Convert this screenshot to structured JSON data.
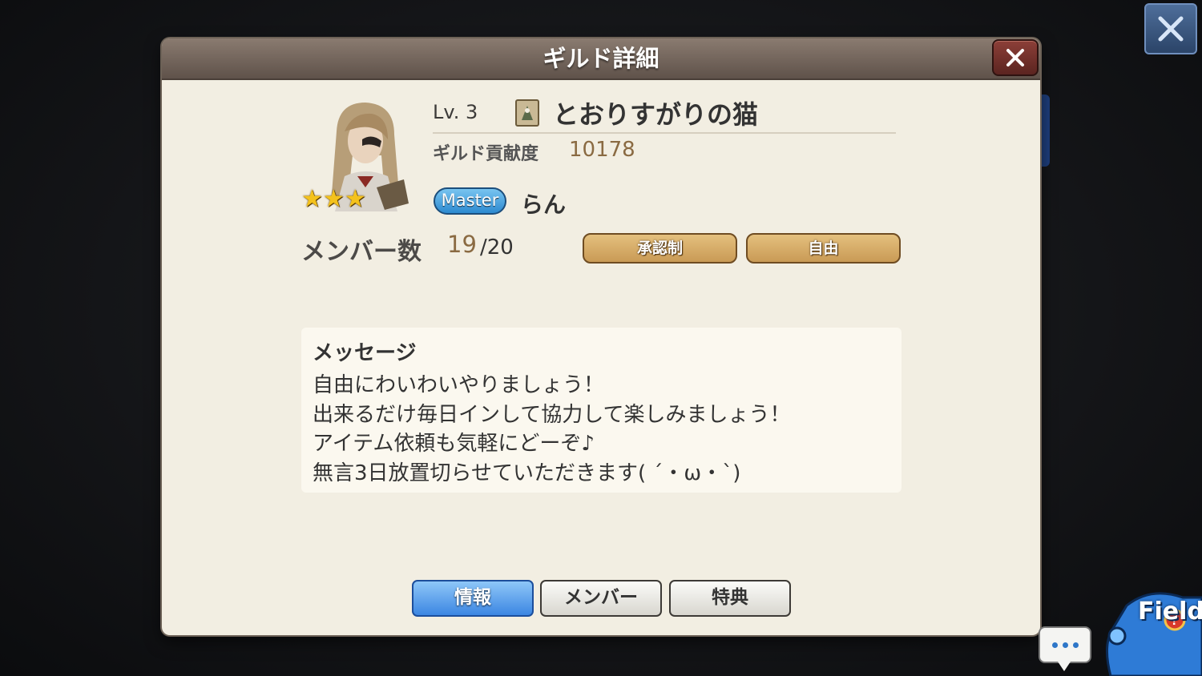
{
  "dialog": {
    "title": "ギルド詳細"
  },
  "guild": {
    "level": "Lv. 3",
    "name": "とおりすがりの猫",
    "contribution_label": "ギルド貢献度",
    "contribution_value": "10178",
    "role_badge": "Master",
    "master_name": "らん",
    "rarity_stars": 3,
    "members_label": "メンバー数",
    "members_count": "19",
    "members_max": "/20",
    "join_policy": "承認制",
    "play_style": "自由"
  },
  "message": {
    "title": "メッセージ",
    "lines": [
      "自由にわいわいやりましょう！",
      "出来るだけ毎日インして協力して楽しみましょう！",
      "アイテム依頼も気軽にどーぞ♪",
      "無言3日放置切らせていただきます( ´・ω・`)"
    ]
  },
  "tabs": {
    "info": "情報",
    "members": "メンバー",
    "benefits": "特典",
    "selected": "情報"
  },
  "hud": {
    "field_label": "Field"
  },
  "colors": {
    "accent_blue": "#3c86e2",
    "gold": "#c99a55",
    "title_bar": "#5f524a"
  }
}
